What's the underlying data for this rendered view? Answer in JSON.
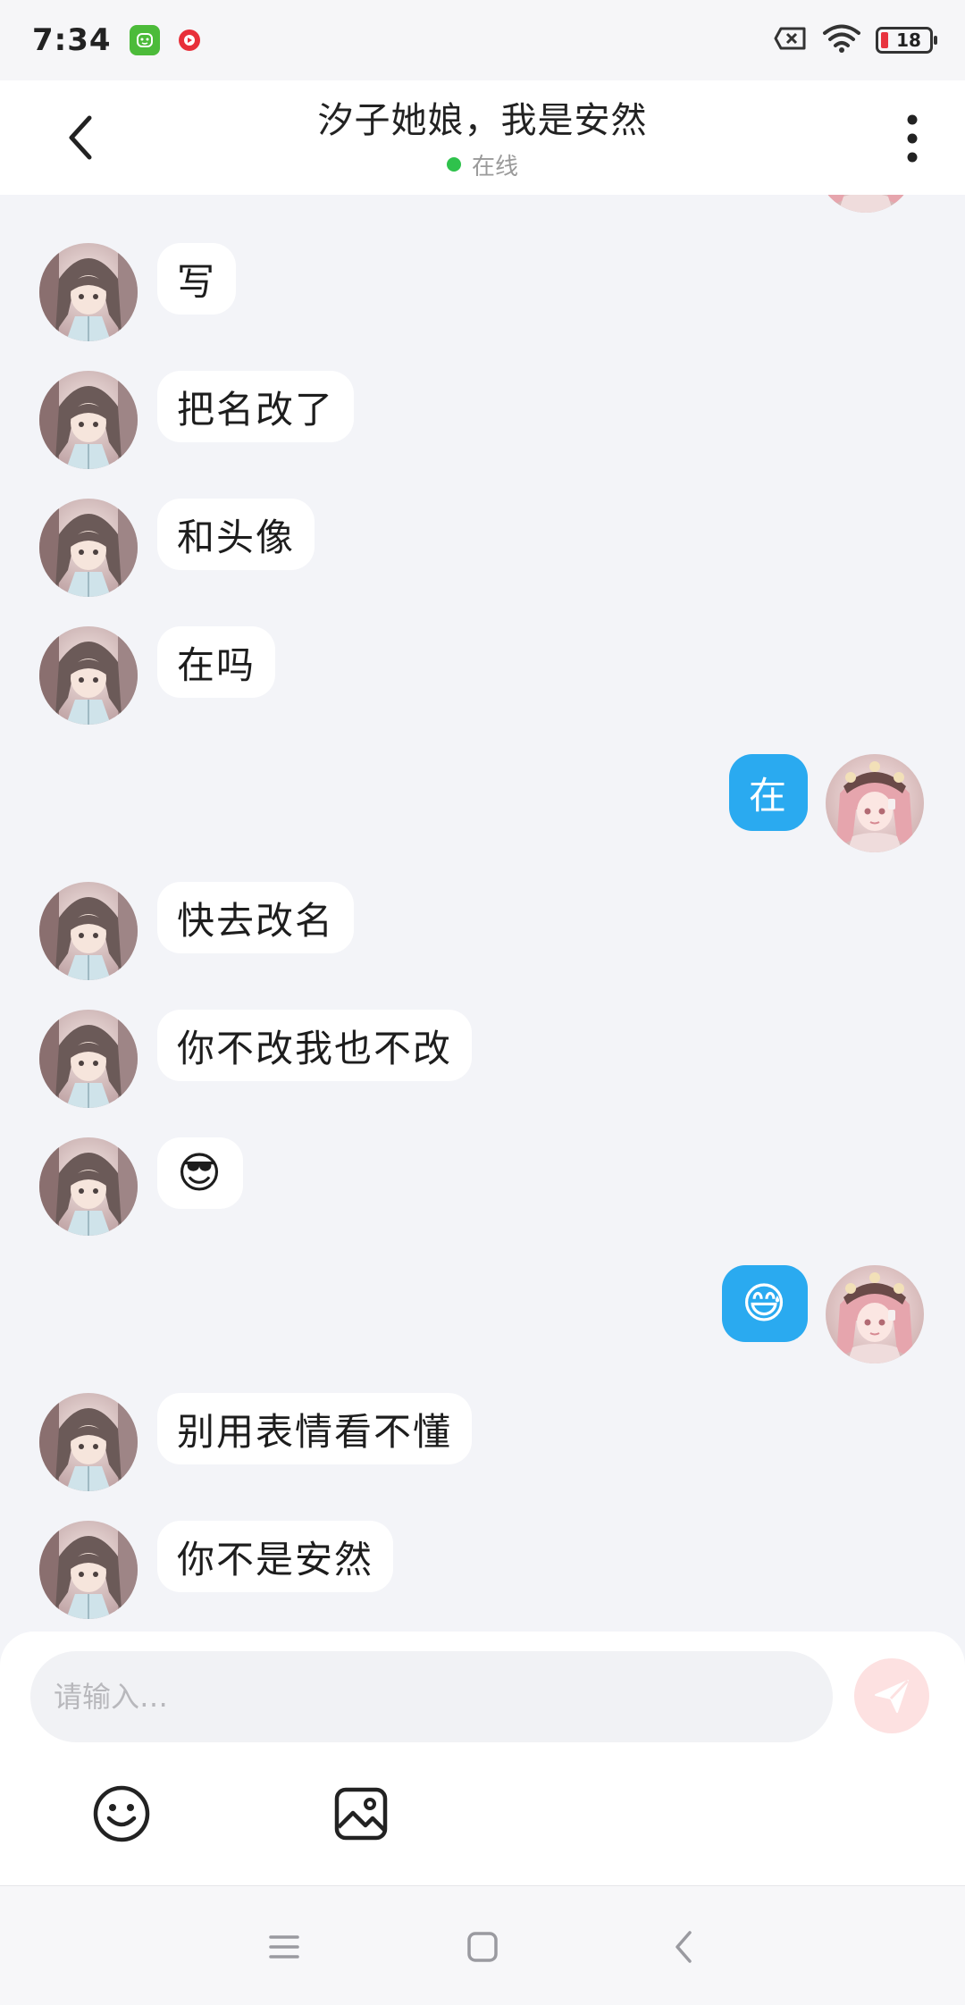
{
  "status_bar": {
    "time": "7:34",
    "battery": "18"
  },
  "header": {
    "title": "汐子她娘，我是安然",
    "presence": "在线",
    "presence_color": "#2fc24c"
  },
  "colors": {
    "outgoing_bubble": "#2aaaf0",
    "incoming_bubble": "#ffffff",
    "background": "#f3f4f8"
  },
  "messages": [
    {
      "side": "left",
      "text": "写"
    },
    {
      "side": "left",
      "text": "把名改了"
    },
    {
      "side": "left",
      "text": "和头像"
    },
    {
      "side": "left",
      "text": "在吗"
    },
    {
      "side": "right",
      "text": "在"
    },
    {
      "side": "left",
      "text": "快去改名"
    },
    {
      "side": "left",
      "text": "你不改我也不改"
    },
    {
      "side": "left",
      "text": "😎"
    },
    {
      "side": "right",
      "text": "😅"
    },
    {
      "side": "left",
      "text": "别用表情看不懂"
    },
    {
      "side": "left",
      "text": "你不是安然"
    }
  ],
  "input": {
    "placeholder": "请输入…",
    "value": ""
  },
  "icons": {
    "back": "back-arrow-icon",
    "more": "more-vertical-icon",
    "send": "send-icon",
    "emoji": "emoji-icon",
    "image": "image-icon"
  }
}
